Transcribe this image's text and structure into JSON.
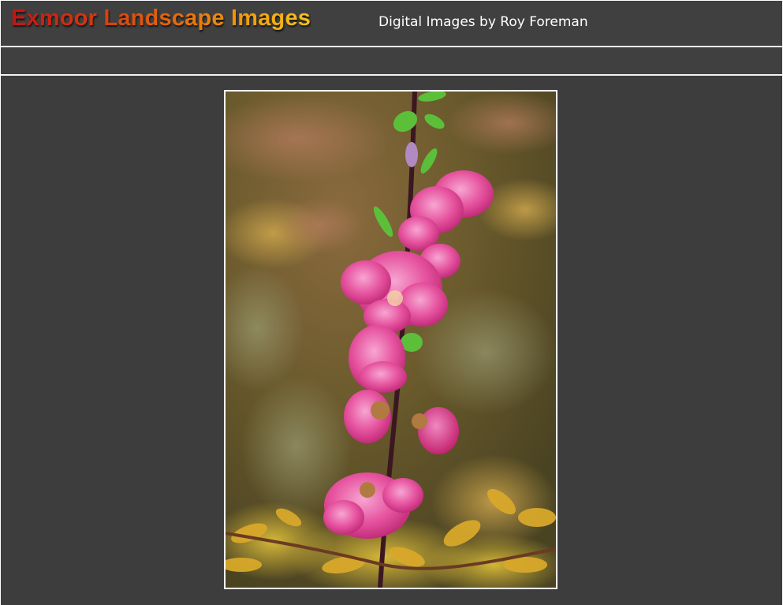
{
  "header": {
    "title": "Exmoor Landscape Images",
    "subtitle": "Digital Images by Roy Foreman"
  },
  "gallery": {
    "image_alt": "Pink blossom on a stem"
  },
  "colors": {
    "background": "#3d3d3d",
    "rule": "#f2f2f2",
    "title_gradient_start": "#c01515",
    "title_gradient_end": "#f6c21a",
    "subtitle": "#ffffff",
    "photo_border": "#ffffff"
  }
}
